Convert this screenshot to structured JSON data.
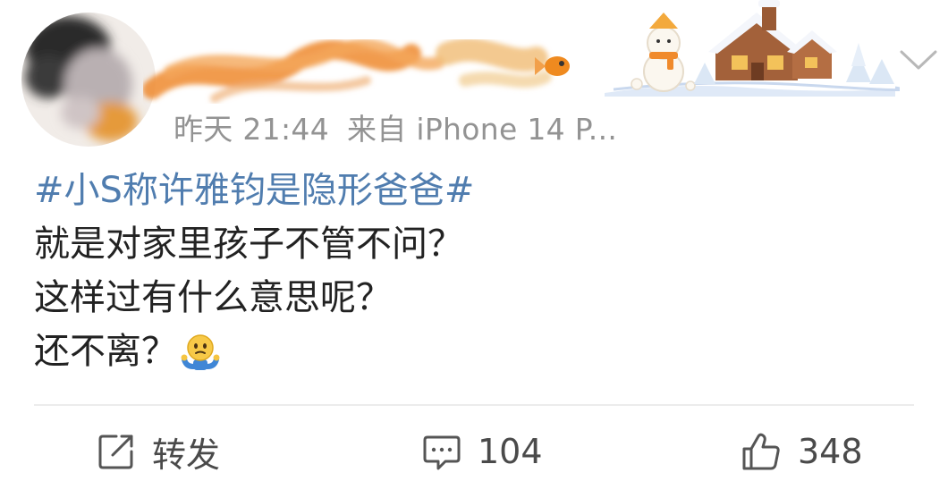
{
  "post": {
    "time": "昨天 21:44",
    "source": "来自 iPhone 14 P...",
    "hashtag": "#小S称许雅钧是隐形爸爸#",
    "lines": [
      "就是对家里孩子不管不问？",
      "这样过有什么意思呢？",
      "还不离？"
    ],
    "emoji": "shrug-emoji"
  },
  "actions": {
    "repost_label": "转发",
    "comment_count": "104",
    "like_count": "348"
  },
  "colors": {
    "hashtag": "#507daf",
    "meta_text": "#939393",
    "body_text": "#222222",
    "action_text": "#4a4a4a"
  }
}
